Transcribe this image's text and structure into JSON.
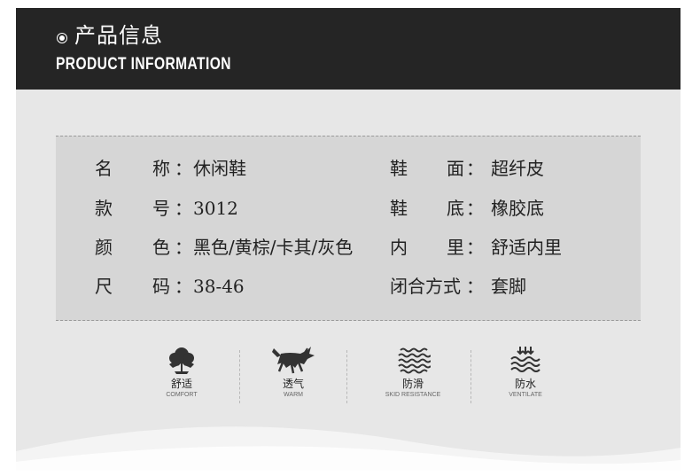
{
  "header": {
    "title_cn": "产品信息",
    "title_en": "PRODUCT INFORMATION"
  },
  "info": {
    "rows": [
      {
        "left": {
          "label_a": "名",
          "label_b": "称",
          "colon": "：",
          "value": "休闲鞋"
        },
        "right": {
          "label_a": "鞋",
          "label_b": "面",
          "colon": "：",
          "value": "超纤皮"
        }
      },
      {
        "left": {
          "label_a": "款",
          "label_b": "号",
          "colon": "：",
          "value": "3012"
        },
        "right": {
          "label_a": "鞋",
          "label_b": "底",
          "colon": "：",
          "value": "橡胶底"
        }
      },
      {
        "left": {
          "label_a": "颜",
          "label_b": "色",
          "colon": "：",
          "value": "黑色/黄棕/卡其/灰色"
        },
        "right": {
          "label_a": "内",
          "label_b": "里",
          "colon": "：",
          "value": "舒适内里"
        }
      },
      {
        "left": {
          "label_a": "尺",
          "label_b": "码",
          "colon": "：",
          "value": "38-46"
        },
        "right": {
          "label": "闭合方式",
          "colon": "：",
          "value": "套脚"
        }
      }
    ]
  },
  "features": [
    {
      "icon": "cotton-flower-icon",
      "cn": "舒适",
      "en": "COMFORT"
    },
    {
      "icon": "bull-icon",
      "cn": "透气",
      "en": "WARM"
    },
    {
      "icon": "waves-icon",
      "cn": "防滑",
      "en": "SKID RESISTANCE"
    },
    {
      "icon": "water-drop-arrows-icon",
      "cn": "防水",
      "en": "VENTILATE"
    }
  ],
  "colors": {
    "header_bg": "#252525",
    "card_bg": "#e7e7e7",
    "info_bg": "#d6d6d6",
    "text": "#222222"
  }
}
